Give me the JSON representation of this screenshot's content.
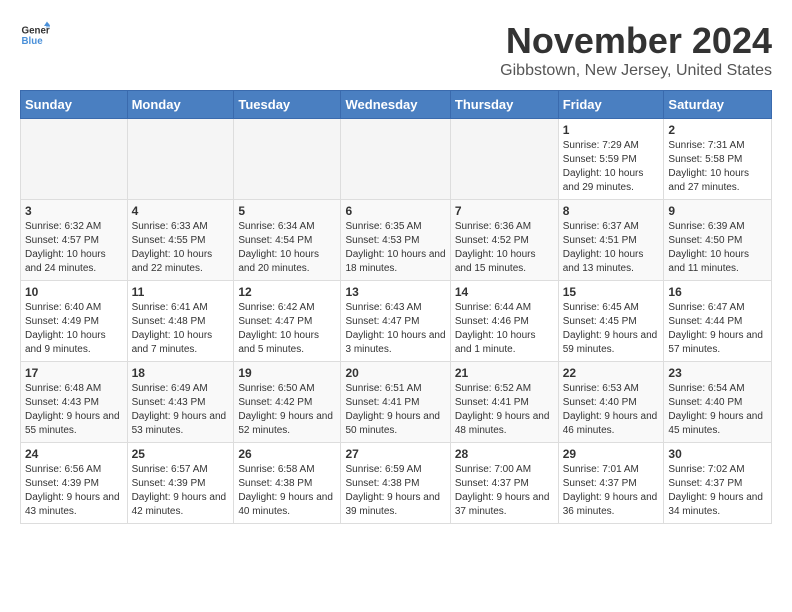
{
  "header": {
    "logo_line1": "General",
    "logo_line2": "Blue",
    "month": "November 2024",
    "location": "Gibbstown, New Jersey, United States"
  },
  "weekdays": [
    "Sunday",
    "Monday",
    "Tuesday",
    "Wednesday",
    "Thursday",
    "Friday",
    "Saturday"
  ],
  "weeks": [
    [
      {
        "day": "",
        "info": ""
      },
      {
        "day": "",
        "info": ""
      },
      {
        "day": "",
        "info": ""
      },
      {
        "day": "",
        "info": ""
      },
      {
        "day": "",
        "info": ""
      },
      {
        "day": "1",
        "info": "Sunrise: 7:29 AM\nSunset: 5:59 PM\nDaylight: 10 hours and 29 minutes."
      },
      {
        "day": "2",
        "info": "Sunrise: 7:31 AM\nSunset: 5:58 PM\nDaylight: 10 hours and 27 minutes."
      }
    ],
    [
      {
        "day": "3",
        "info": "Sunrise: 6:32 AM\nSunset: 4:57 PM\nDaylight: 10 hours and 24 minutes."
      },
      {
        "day": "4",
        "info": "Sunrise: 6:33 AM\nSunset: 4:55 PM\nDaylight: 10 hours and 22 minutes."
      },
      {
        "day": "5",
        "info": "Sunrise: 6:34 AM\nSunset: 4:54 PM\nDaylight: 10 hours and 20 minutes."
      },
      {
        "day": "6",
        "info": "Sunrise: 6:35 AM\nSunset: 4:53 PM\nDaylight: 10 hours and 18 minutes."
      },
      {
        "day": "7",
        "info": "Sunrise: 6:36 AM\nSunset: 4:52 PM\nDaylight: 10 hours and 15 minutes."
      },
      {
        "day": "8",
        "info": "Sunrise: 6:37 AM\nSunset: 4:51 PM\nDaylight: 10 hours and 13 minutes."
      },
      {
        "day": "9",
        "info": "Sunrise: 6:39 AM\nSunset: 4:50 PM\nDaylight: 10 hours and 11 minutes."
      }
    ],
    [
      {
        "day": "10",
        "info": "Sunrise: 6:40 AM\nSunset: 4:49 PM\nDaylight: 10 hours and 9 minutes."
      },
      {
        "day": "11",
        "info": "Sunrise: 6:41 AM\nSunset: 4:48 PM\nDaylight: 10 hours and 7 minutes."
      },
      {
        "day": "12",
        "info": "Sunrise: 6:42 AM\nSunset: 4:47 PM\nDaylight: 10 hours and 5 minutes."
      },
      {
        "day": "13",
        "info": "Sunrise: 6:43 AM\nSunset: 4:47 PM\nDaylight: 10 hours and 3 minutes."
      },
      {
        "day": "14",
        "info": "Sunrise: 6:44 AM\nSunset: 4:46 PM\nDaylight: 10 hours and 1 minute."
      },
      {
        "day": "15",
        "info": "Sunrise: 6:45 AM\nSunset: 4:45 PM\nDaylight: 9 hours and 59 minutes."
      },
      {
        "day": "16",
        "info": "Sunrise: 6:47 AM\nSunset: 4:44 PM\nDaylight: 9 hours and 57 minutes."
      }
    ],
    [
      {
        "day": "17",
        "info": "Sunrise: 6:48 AM\nSunset: 4:43 PM\nDaylight: 9 hours and 55 minutes."
      },
      {
        "day": "18",
        "info": "Sunrise: 6:49 AM\nSunset: 4:43 PM\nDaylight: 9 hours and 53 minutes."
      },
      {
        "day": "19",
        "info": "Sunrise: 6:50 AM\nSunset: 4:42 PM\nDaylight: 9 hours and 52 minutes."
      },
      {
        "day": "20",
        "info": "Sunrise: 6:51 AM\nSunset: 4:41 PM\nDaylight: 9 hours and 50 minutes."
      },
      {
        "day": "21",
        "info": "Sunrise: 6:52 AM\nSunset: 4:41 PM\nDaylight: 9 hours and 48 minutes."
      },
      {
        "day": "22",
        "info": "Sunrise: 6:53 AM\nSunset: 4:40 PM\nDaylight: 9 hours and 46 minutes."
      },
      {
        "day": "23",
        "info": "Sunrise: 6:54 AM\nSunset: 4:40 PM\nDaylight: 9 hours and 45 minutes."
      }
    ],
    [
      {
        "day": "24",
        "info": "Sunrise: 6:56 AM\nSunset: 4:39 PM\nDaylight: 9 hours and 43 minutes."
      },
      {
        "day": "25",
        "info": "Sunrise: 6:57 AM\nSunset: 4:39 PM\nDaylight: 9 hours and 42 minutes."
      },
      {
        "day": "26",
        "info": "Sunrise: 6:58 AM\nSunset: 4:38 PM\nDaylight: 9 hours and 40 minutes."
      },
      {
        "day": "27",
        "info": "Sunrise: 6:59 AM\nSunset: 4:38 PM\nDaylight: 9 hours and 39 minutes."
      },
      {
        "day": "28",
        "info": "Sunrise: 7:00 AM\nSunset: 4:37 PM\nDaylight: 9 hours and 37 minutes."
      },
      {
        "day": "29",
        "info": "Sunrise: 7:01 AM\nSunset: 4:37 PM\nDaylight: 9 hours and 36 minutes."
      },
      {
        "day": "30",
        "info": "Sunrise: 7:02 AM\nSunset: 4:37 PM\nDaylight: 9 hours and 34 minutes."
      }
    ]
  ]
}
